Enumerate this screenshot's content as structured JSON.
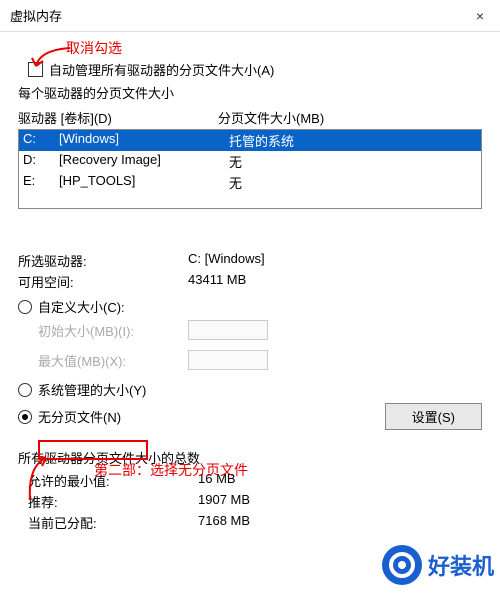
{
  "titlebar": {
    "title": "虚拟内存",
    "close": "×"
  },
  "annotations": {
    "calloutTop": "取消勾选",
    "calloutBottom": "第二部：选择无分页文件"
  },
  "autoManage": {
    "label": "自动管理所有驱动器的分页文件大小(A)"
  },
  "group": {
    "legend": "每个驱动器的分页文件大小",
    "headerDrive": "驱动器 [卷标](D)",
    "headerSize": "分页文件大小(MB)",
    "rows": [
      {
        "letter": "C:",
        "label": "[Windows]",
        "size": "托管的系统"
      },
      {
        "letter": "D:",
        "label": "[Recovery Image]",
        "size": "无"
      },
      {
        "letter": "E:",
        "label": "[HP_TOOLS]",
        "size": "无"
      }
    ],
    "selectedDriveLabel": "所选驱动器:",
    "selectedDriveValue": "C:  [Windows]",
    "freeSpaceLabel": "可用空间:",
    "freeSpaceValue": "43411 MB",
    "customSizeLabel": "自定义大小(C):",
    "initialSizeLabel": "初始大小(MB)(I):",
    "maxSizeLabel": "最大值(MB)(X):",
    "systemManagedLabel": "系统管理的大小(Y)",
    "noPagingFileLabel": "无分页文件(N)",
    "setButton": "设置(S)"
  },
  "totals": {
    "legend": "所有驱动器分页文件大小的总数",
    "minAllowedLabel": "允许的最小值:",
    "minAllowedValue": "16 MB",
    "recommendedLabel": "推荐:",
    "recommendedValue": "1907 MB",
    "currentLabel": "当前已分配:",
    "currentValue": "7168 MB"
  },
  "watermark": {
    "text": "好装机"
  }
}
